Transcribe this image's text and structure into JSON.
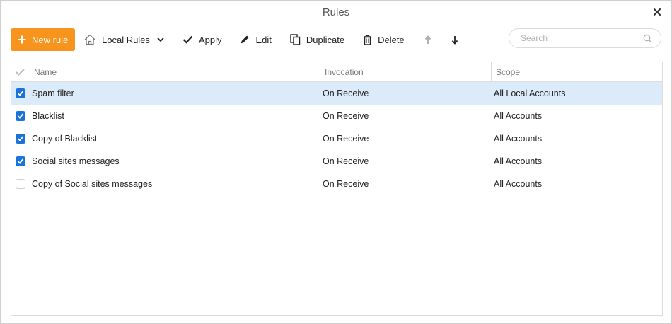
{
  "window": {
    "title": "Rules"
  },
  "toolbar": {
    "new_rule": "New rule",
    "local_rules": "Local Rules",
    "apply": "Apply",
    "edit": "Edit",
    "duplicate": "Duplicate",
    "delete": "Delete"
  },
  "search": {
    "placeholder": "Search"
  },
  "table": {
    "columns": {
      "name": "Name",
      "invocation": "Invocation",
      "scope": "Scope"
    },
    "rows": [
      {
        "checked": true,
        "selected": true,
        "name": "Spam filter",
        "invocation": "On Receive",
        "scope": "All Local Accounts"
      },
      {
        "checked": true,
        "selected": false,
        "name": "Blacklist",
        "invocation": "On Receive",
        "scope": "All Accounts"
      },
      {
        "checked": true,
        "selected": false,
        "name": "Copy of Blacklist",
        "invocation": "On Receive",
        "scope": "All Accounts"
      },
      {
        "checked": true,
        "selected": false,
        "name": "Social sites messages",
        "invocation": "On Receive",
        "scope": "All Accounts"
      },
      {
        "checked": false,
        "selected": false,
        "name": "Copy of Social sites messages",
        "invocation": "On Receive",
        "scope": "All Accounts"
      }
    ]
  },
  "colors": {
    "accent": "#f7941d",
    "checkbox": "#1a73d9",
    "selected_row": "#dcebfa"
  }
}
